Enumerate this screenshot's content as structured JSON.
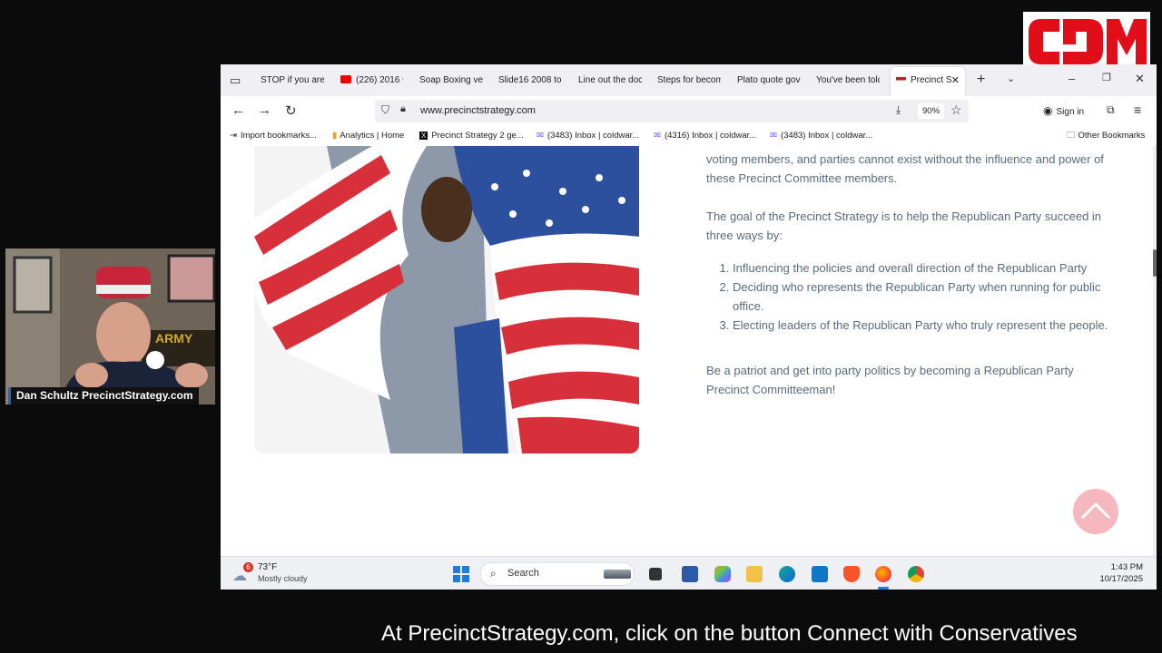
{
  "webcam": {
    "name_label": "Dan Schultz PrecinctStrategy.com"
  },
  "browser": {
    "tabs": [
      {
        "label": "STOP if you are"
      },
      {
        "label": "(226) 2016 C"
      },
      {
        "label": "Soap Boxing ver"
      },
      {
        "label": "Slide16 2008 to"
      },
      {
        "label": "Line out the doc"
      },
      {
        "label": "Steps for becom"
      },
      {
        "label": "Plato quote gove"
      },
      {
        "label": "You've been told"
      },
      {
        "label": "Precinct S"
      }
    ],
    "url": "www.precinctstrategy.com",
    "zoom": "90%",
    "sign_in": "Sign in",
    "bookmarks": [
      {
        "label": "Import bookmarks..."
      },
      {
        "label": "Analytics | Home"
      },
      {
        "label": "Precinct Strategy 2 ge..."
      },
      {
        "label": "(3483) Inbox | coldwar..."
      },
      {
        "label": "(4316) Inbox | coldwar..."
      },
      {
        "label": "(3483) Inbox | coldwar..."
      }
    ],
    "other_bookmarks": "Other Bookmarks"
  },
  "page": {
    "intro": "voting members, and parties cannot exist without the influence and power of these Precinct Committee members.",
    "goal": "The goal of the Precinct Strategy is to help the Republican Party succeed in three ways by:",
    "ways": [
      "Influencing the policies and overall direction of the Republican Party",
      "Deciding who represents the Republican Party when running for public office.",
      "Electing leaders of the Republican Party who truly represent the people."
    ],
    "cta": "Be a patriot and get into party politics by becoming a Republican Party Precinct Committeeman!"
  },
  "taskbar": {
    "weather_temp": "73°F",
    "weather_desc": "Mostly cloudy",
    "weather_badge": "6",
    "search_label": "Search",
    "time": "1:43 PM",
    "date": "10/17/2025"
  },
  "caption": {
    "text": "At PrecinctStrategy.com, click on the button Connect with Conservatives"
  },
  "colors": {
    "logo_red": "#e10e1a",
    "scroll_top": "#f7b7bf",
    "text": "#5a6b7c"
  }
}
